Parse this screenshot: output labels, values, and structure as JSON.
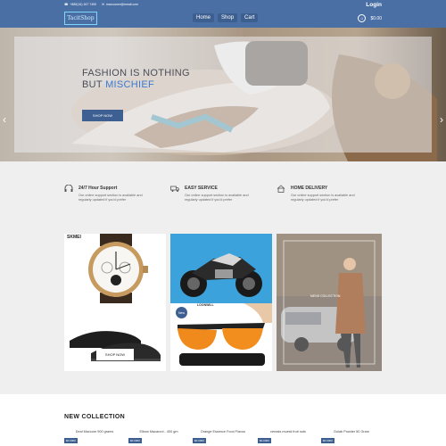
{
  "header": {
    "phone": "+880(16) 167 7490",
    "email": "marcocore@email.com",
    "logo": "TacitShop",
    "nav": [
      "Home",
      "Shop",
      "Cart"
    ],
    "login": "Login",
    "cart_total": "$0.00"
  },
  "hero": {
    "title_line1": "FASHION IS NOTHING",
    "title_line2_prefix": "BUT ",
    "title_accent": "MISCHIEF",
    "button": "SHOP NOW"
  },
  "features": [
    {
      "title": "24/7 Hour Support",
      "desc": "Our online support section is available and regularly updated if you'd prefer",
      "icon": "headset-icon"
    },
    {
      "title": "EASY SERVICE",
      "desc": "Our online support section is available and regularly updated if you'd prefer",
      "icon": "truck-icon"
    },
    {
      "title": "HOME DELIVERY",
      "desc": "Our online support section is available and regularly updated if you'd prefer",
      "icon": "home-icon"
    }
  ],
  "tiles": {
    "watch_brand": "SKMEI",
    "shoes_label": "SHOP NOW",
    "sunglasses_badge": "New",
    "sunglasses_brand": "LOONWILL",
    "mens_label": "MENS COLLECTION"
  },
  "collection": {
    "title": "NEW COLLECTION",
    "products": [
      {
        "name": "Deal Maxcore 900 grams",
        "tag": "$0.0000"
      },
      {
        "name": "Elbow Macaroni - 400 gm",
        "tag": "$0.0000"
      },
      {
        "name": "Orange Essence Food Flavou",
        "tag": "$0.0000"
      },
      {
        "name": "cereals muesli fruit nuts",
        "tag": "$0.0000"
      },
      {
        "name": "Gulab Powder 50 Gram",
        "tag": "$0.0000"
      }
    ]
  },
  "colors": {
    "header": "#4a6fa5",
    "accent": "#3a7bd5",
    "button": "#3e5f91"
  }
}
